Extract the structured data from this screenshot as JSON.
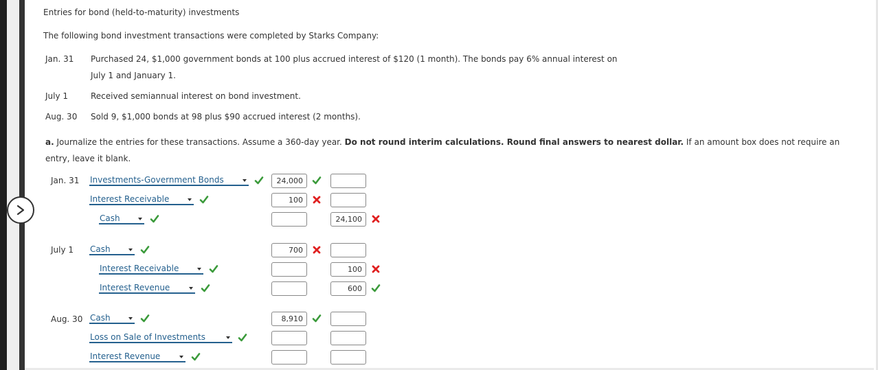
{
  "title": "Entries for bond (held-to-maturity) investments",
  "intro": "The following bond investment transactions were completed by Starks Company:",
  "transactions": [
    {
      "date": "Jan. 31",
      "line1": "Purchased 24, $1,000 government bonds at 100 plus accrued interest of $120 (1 month). The bonds pay 6% annual interest on",
      "line2": "July 1 and January 1."
    },
    {
      "date": "July 1",
      "line1": "Received semiannual interest on bond investment."
    },
    {
      "date": "Aug. 30",
      "line1": "Sold 9, $1,000 bonds at 98 plus $90 accrued interest (2 months)."
    }
  ],
  "instructions": {
    "part": "a.",
    "text1": " Journalize the entries for these transactions. Assume a 360-day year. ",
    "bold": "Do not round interim calculations. Round final answers to nearest dollar.",
    "text2": " If an amount box does not require an",
    "text3": "entry, leave it blank."
  },
  "colors": {
    "accent": "#24608e",
    "correct": "#3a9a3a",
    "incorrect": "#e02020"
  },
  "journal": [
    {
      "date": "Jan. 31",
      "lines": [
        {
          "account": "Investments-Government Bonds",
          "account_status": "correct",
          "debit": "24,000",
          "debit_status": "correct",
          "credit": "",
          "credit_status": ""
        },
        {
          "account": "Interest Receivable",
          "account_status": "correct",
          "debit": "100",
          "debit_status": "incorrect",
          "credit": "",
          "credit_status": ""
        },
        {
          "account": "Cash",
          "account_status": "correct",
          "debit": "",
          "debit_status": "",
          "credit": "24,100",
          "credit_status": "incorrect"
        }
      ]
    },
    {
      "date": "July 1",
      "lines": [
        {
          "account": "Cash",
          "account_status": "correct",
          "debit": "700",
          "debit_status": "incorrect",
          "credit": "",
          "credit_status": ""
        },
        {
          "account": "Interest Receivable",
          "account_status": "correct",
          "debit": "",
          "debit_status": "",
          "credit": "100",
          "credit_status": "incorrect"
        },
        {
          "account": "Interest Revenue",
          "account_status": "correct",
          "debit": "",
          "debit_status": "",
          "credit": "600",
          "credit_status": "correct"
        }
      ]
    },
    {
      "date": "Aug. 30",
      "lines": [
        {
          "account": "Cash",
          "account_status": "correct",
          "debit": "8,910",
          "debit_status": "correct",
          "credit": "",
          "credit_status": ""
        },
        {
          "account": "Loss on Sale of Investments",
          "account_status": "correct",
          "debit": "",
          "debit_status": "",
          "credit": "",
          "credit_status": ""
        },
        {
          "account": "Interest Revenue",
          "account_status": "correct",
          "debit": "",
          "debit_status": "",
          "credit": "",
          "credit_status": ""
        }
      ]
    }
  ]
}
